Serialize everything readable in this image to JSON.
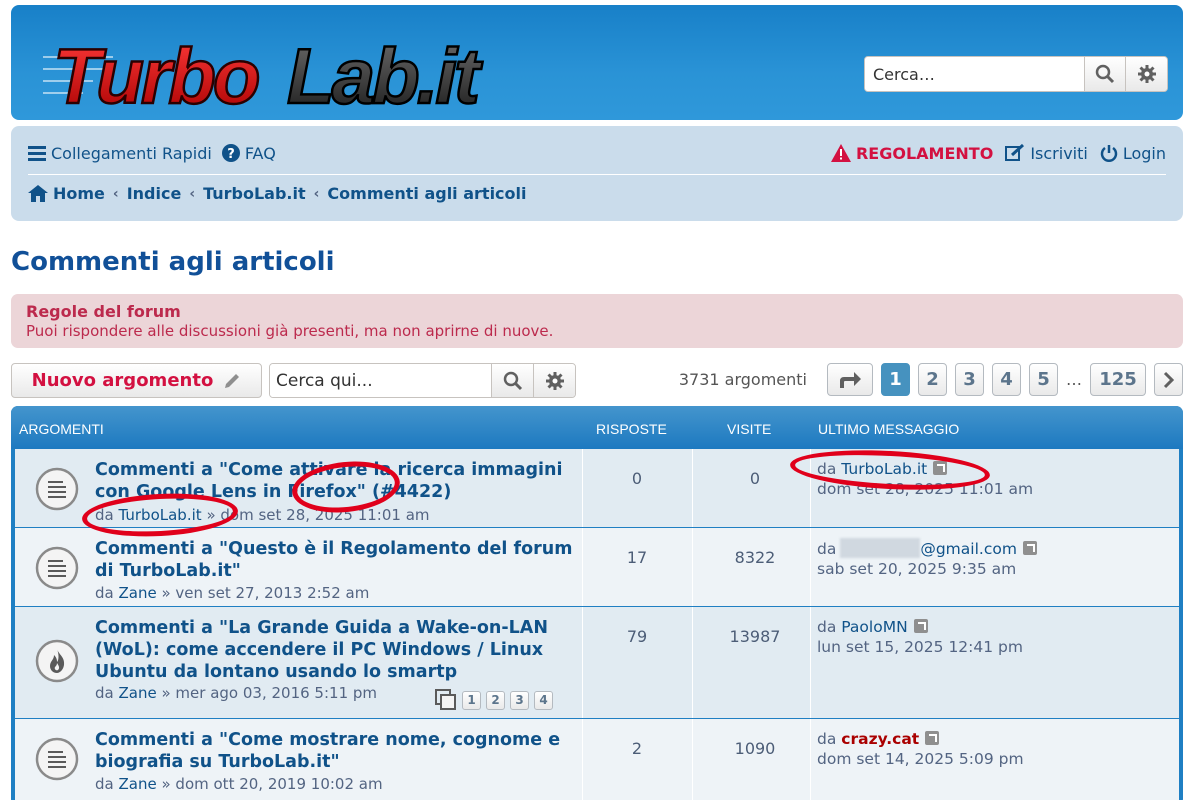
{
  "site": {
    "logo_text": "TurboLab.it",
    "search_placeholder": "Cerca…"
  },
  "nav": {
    "quick_links": "Collegamenti Rapidi",
    "faq": "FAQ",
    "rules": "REGOLAMENTO",
    "register": "Iscriviti",
    "login": "Login",
    "breadcrumbs": [
      "Home",
      "Indice",
      "TurboLab.it",
      "Commenti agli articoli"
    ]
  },
  "page": {
    "title": "Commenti agli articoli",
    "rules_title": "Regole del forum",
    "rules_text": "Puoi rispondere alle discussioni già presenti, ma non aprirne di nuove."
  },
  "actions": {
    "new_topic": "Nuovo argomento",
    "search_placeholder": "Cerca qui...",
    "topic_count": "3731 argomenti",
    "pages": [
      "1",
      "2",
      "3",
      "4",
      "5"
    ],
    "ellipsis": "…",
    "last_page": "125",
    "current_page": "1"
  },
  "table": {
    "headers": {
      "topics": "Argomenti",
      "replies": "Risposte",
      "views": "Visite",
      "last_post": "Ultimo messaggio"
    },
    "rows": [
      {
        "title": "Commenti a \"Come attivare la ricerca immagini con Google Lens in Firefox\" (#4422)",
        "by": "da",
        "author": "TurboLab.it",
        "date": "» dom set 28, 2025 11:01 am",
        "replies": "0",
        "views": "0",
        "last_by": "da",
        "last_user": "TurboLab.it",
        "last_date": "dom set 28, 2025 11:01 am",
        "icon": "topic-read-icon"
      },
      {
        "title": "Commenti a \"Questo è il Regolamento del forum di TurboLab.it\"",
        "by": "da",
        "author": "Zane",
        "date": "» ven set 27, 2013 2:52 am",
        "replies": "17",
        "views": "8322",
        "last_by": "da",
        "last_user": "@gmail.com",
        "last_date": "sab set 20, 2025 9:35 am",
        "icon": "topic-read-icon"
      },
      {
        "title": "Commenti a \"La Grande Guida a Wake-on-LAN (WoL): come accendere il PC Windows / Linux Ubuntu da lontano usando lo smartp",
        "by": "da",
        "author": "Zane",
        "date": "» mer ago 03, 2016 5:11 pm",
        "replies": "79",
        "views": "13987",
        "last_by": "da",
        "last_user": "PaoloMN",
        "last_date": "lun set 15, 2025 12:41 pm",
        "icon": "hot-topic-icon",
        "mini_pages": [
          "1",
          "2",
          "3",
          "4"
        ]
      },
      {
        "title": "Commenti a \"Come mostrare nome, cognome e biografia su TurboLab.it\"",
        "by": "da",
        "author": "Zane",
        "date": "» dom ott 20, 2019 10:02 am",
        "replies": "2",
        "views": "1090",
        "last_by": "da",
        "last_user": "crazy.cat",
        "last_date": "dom set 14, 2025 5:09 pm",
        "icon": "topic-read-icon"
      }
    ]
  },
  "colors": {
    "header_blue": "#1880c8",
    "link_blue": "#105289",
    "rules_red": "#d31141",
    "annotation_red": "#e0001b"
  }
}
